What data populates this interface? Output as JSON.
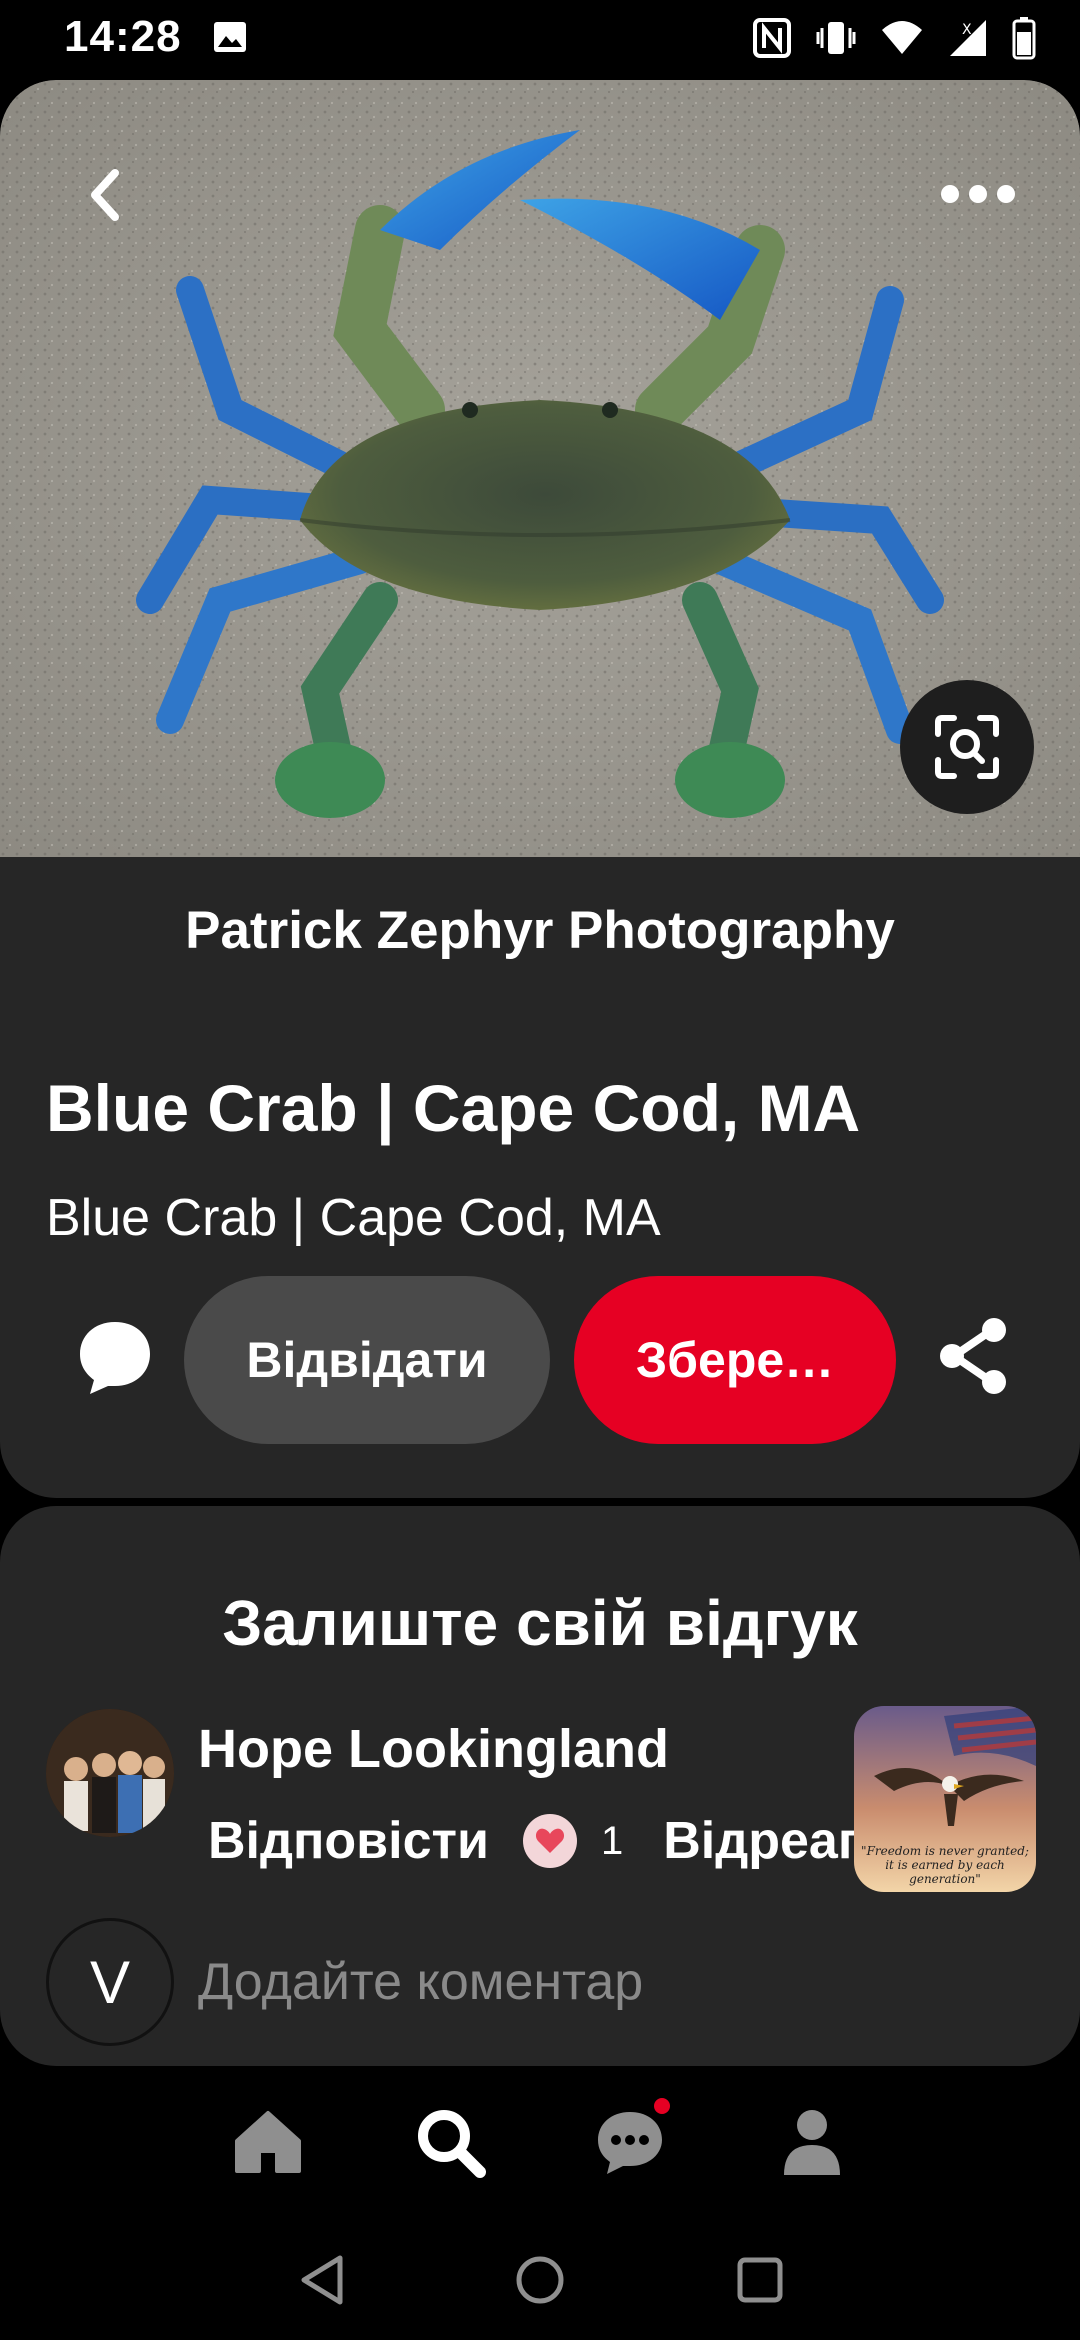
{
  "status_bar": {
    "time": "14:28",
    "icons": [
      "gallery-icon",
      "nfc-icon",
      "vibrate-icon",
      "wifi-icon",
      "signal-icon",
      "battery-icon"
    ]
  },
  "pin": {
    "image_alt": "crab-photo",
    "source_name": "Patrick Zephyr Photography",
    "title": "Blue Crab | Cape Cod, MA",
    "description": "Blue Crab | Cape Cod, MA",
    "visit_label": "Відвідати",
    "save_label": "Збере…"
  },
  "comments": {
    "heading": "Залиште свій відгук",
    "items": [
      {
        "author": "Hope Lookingland",
        "reply_label": "Відповісти",
        "reaction_count": "1",
        "react_label": "Відреагувати",
        "image_caption_1": "\"Freedom is never granted;",
        "image_caption_2": "it is earned by each generation\""
      }
    ],
    "my_initial": "V",
    "add_placeholder": "Додайте коментар"
  },
  "bottom_nav": {
    "items": [
      "home-icon",
      "search-icon",
      "messages-icon",
      "profile-icon"
    ],
    "active": "search-icon"
  },
  "colors": {
    "accent": "#e60023",
    "card_bg": "#262626",
    "visit_bg": "#4a4a4a"
  }
}
